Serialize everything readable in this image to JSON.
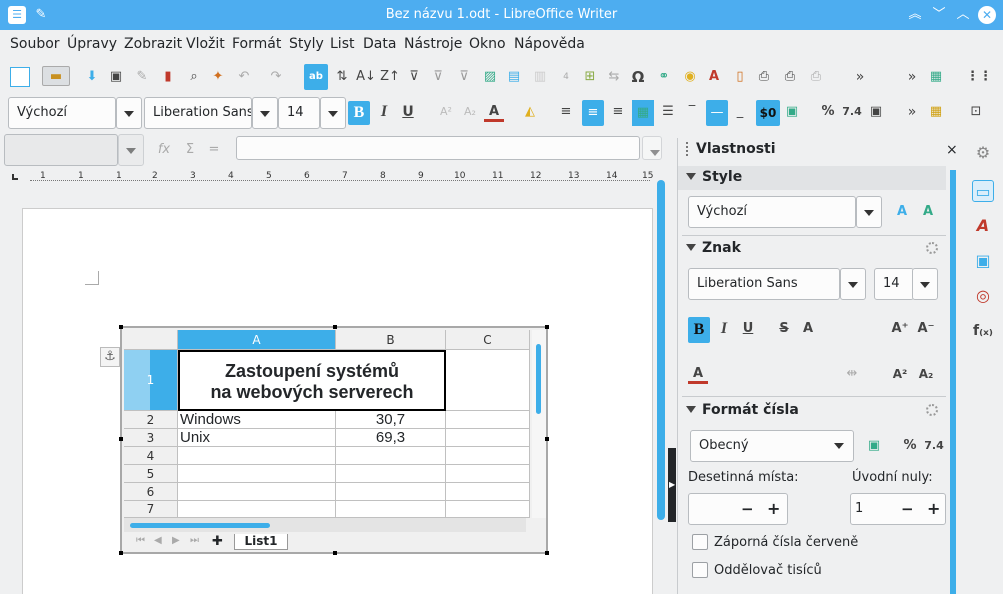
{
  "window": {
    "title": "Bez názvu 1.odt - LibreOffice Writer"
  },
  "menu": [
    "Soubor",
    "Úpravy",
    "Zobrazit",
    "Vložit",
    "Formát",
    "Styly",
    "List",
    "Data",
    "Nástroje",
    "Okno",
    "Nápověda"
  ],
  "toolbar": {
    "style_value": "Výchozí",
    "font_value": "Liberation Sans",
    "size_value": "14",
    "omega": "Ω",
    "overflow": "»",
    "currency": "$0",
    "percent": "%",
    "decimal": "7.4",
    "fx": "fx",
    "sigma": "Σ",
    "equals": "="
  },
  "ruler": [
    "1",
    "1",
    "1",
    "2",
    "3",
    "4",
    "5",
    "6",
    "7",
    "8",
    "9",
    "10",
    "11",
    "12",
    "13",
    "14",
    "15"
  ],
  "sheet": {
    "columns": [
      "A",
      "B",
      "C"
    ],
    "rows": [
      "1",
      "2",
      "3",
      "4",
      "5",
      "6",
      "7"
    ],
    "title_line1": "Zastoupení systémů",
    "title_line2": "na webových serverech",
    "data": [
      {
        "os": "Windows",
        "val": "30,7"
      },
      {
        "os": "Unix",
        "val": "69,3"
      }
    ],
    "tab": "List1"
  },
  "sidebar": {
    "title": "Vlastnosti",
    "style_section": "Style",
    "style_value": "Výchozí",
    "char_section": "Znak",
    "font_value": "Liberation Sans",
    "size_value": "14",
    "num_section": "Formát čísla",
    "num_value": "Obecný",
    "decimals_label": "Desetinná místa:",
    "leading_label": "Úvodní nuly:",
    "leading_value": "1",
    "neg_red": "Záporná čísla červeně",
    "thousands": "Oddělovač tisíců",
    "percent": "%",
    "decimal": "7.4",
    "minus": "−",
    "plus": "+"
  }
}
